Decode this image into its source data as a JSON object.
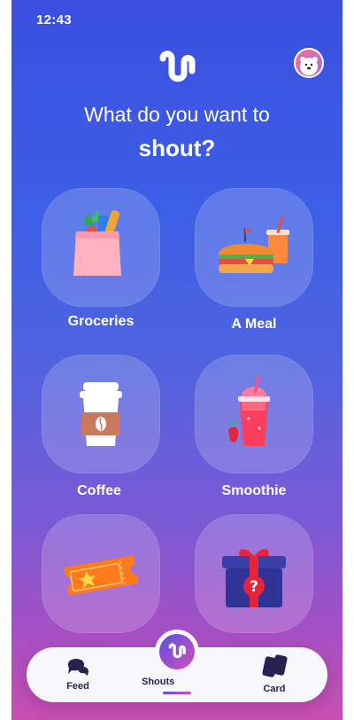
{
  "status": {
    "time": "12:43"
  },
  "header": {
    "line1": "What do you want to",
    "line2": "shout?"
  },
  "tiles": [
    {
      "label": "Groceries",
      "icon": "grocery-bag-icon"
    },
    {
      "label": "A Meal",
      "icon": "sandwich-and-drink-icon"
    },
    {
      "label": "Coffee",
      "icon": "coffee-cup-icon"
    },
    {
      "label": "Smoothie",
      "icon": "smoothie-icon"
    },
    {
      "label": "",
      "icon": "ticket-icon"
    },
    {
      "label": "",
      "icon": "mystery-gift-icon"
    }
  ],
  "nav": {
    "feed": "Feed",
    "shouts": "Shouts",
    "card": "Card"
  },
  "colors": {
    "gradient_top": "#3a4fe0",
    "gradient_bottom": "#c94fb0",
    "nav_text": "#272350"
  }
}
